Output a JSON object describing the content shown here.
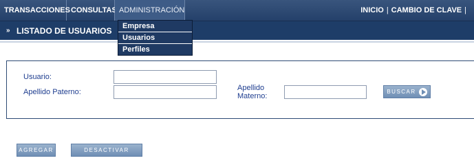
{
  "nav": {
    "items": [
      {
        "label": "TRANSACCIONES"
      },
      {
        "label": "CONSULTAS"
      },
      {
        "label": "ADMINISTRACIÓN"
      }
    ],
    "right": {
      "inicio": "INICIO",
      "separator": "|",
      "cambio_clave": "CAMBIO DE CLAVE"
    }
  },
  "dropdown": {
    "items": [
      {
        "label": "Empresa"
      },
      {
        "label": "Usuarios"
      },
      {
        "label": "Perfiles"
      }
    ]
  },
  "section": {
    "arrows": "»",
    "title": "LISTADO DE USUARIOS"
  },
  "filters": {
    "usuario_label": "Usuario:",
    "usuario_value": "",
    "ap_paterno_label": "Apellido Paterno:",
    "ap_paterno_value": "",
    "ap_materno_label_1": "Apellido",
    "ap_materno_label_2": "Materno:",
    "ap_materno_value": ""
  },
  "buttons": {
    "buscar": "BUSCAR",
    "agregar": "AGREGAR",
    "desactivar": "DESACTIVAR"
  },
  "colors": {
    "nav_bg": "#2b4772",
    "title_bg": "#1e3d68",
    "label_text": "#1e3d8f",
    "button_bg": "#819fc2"
  }
}
